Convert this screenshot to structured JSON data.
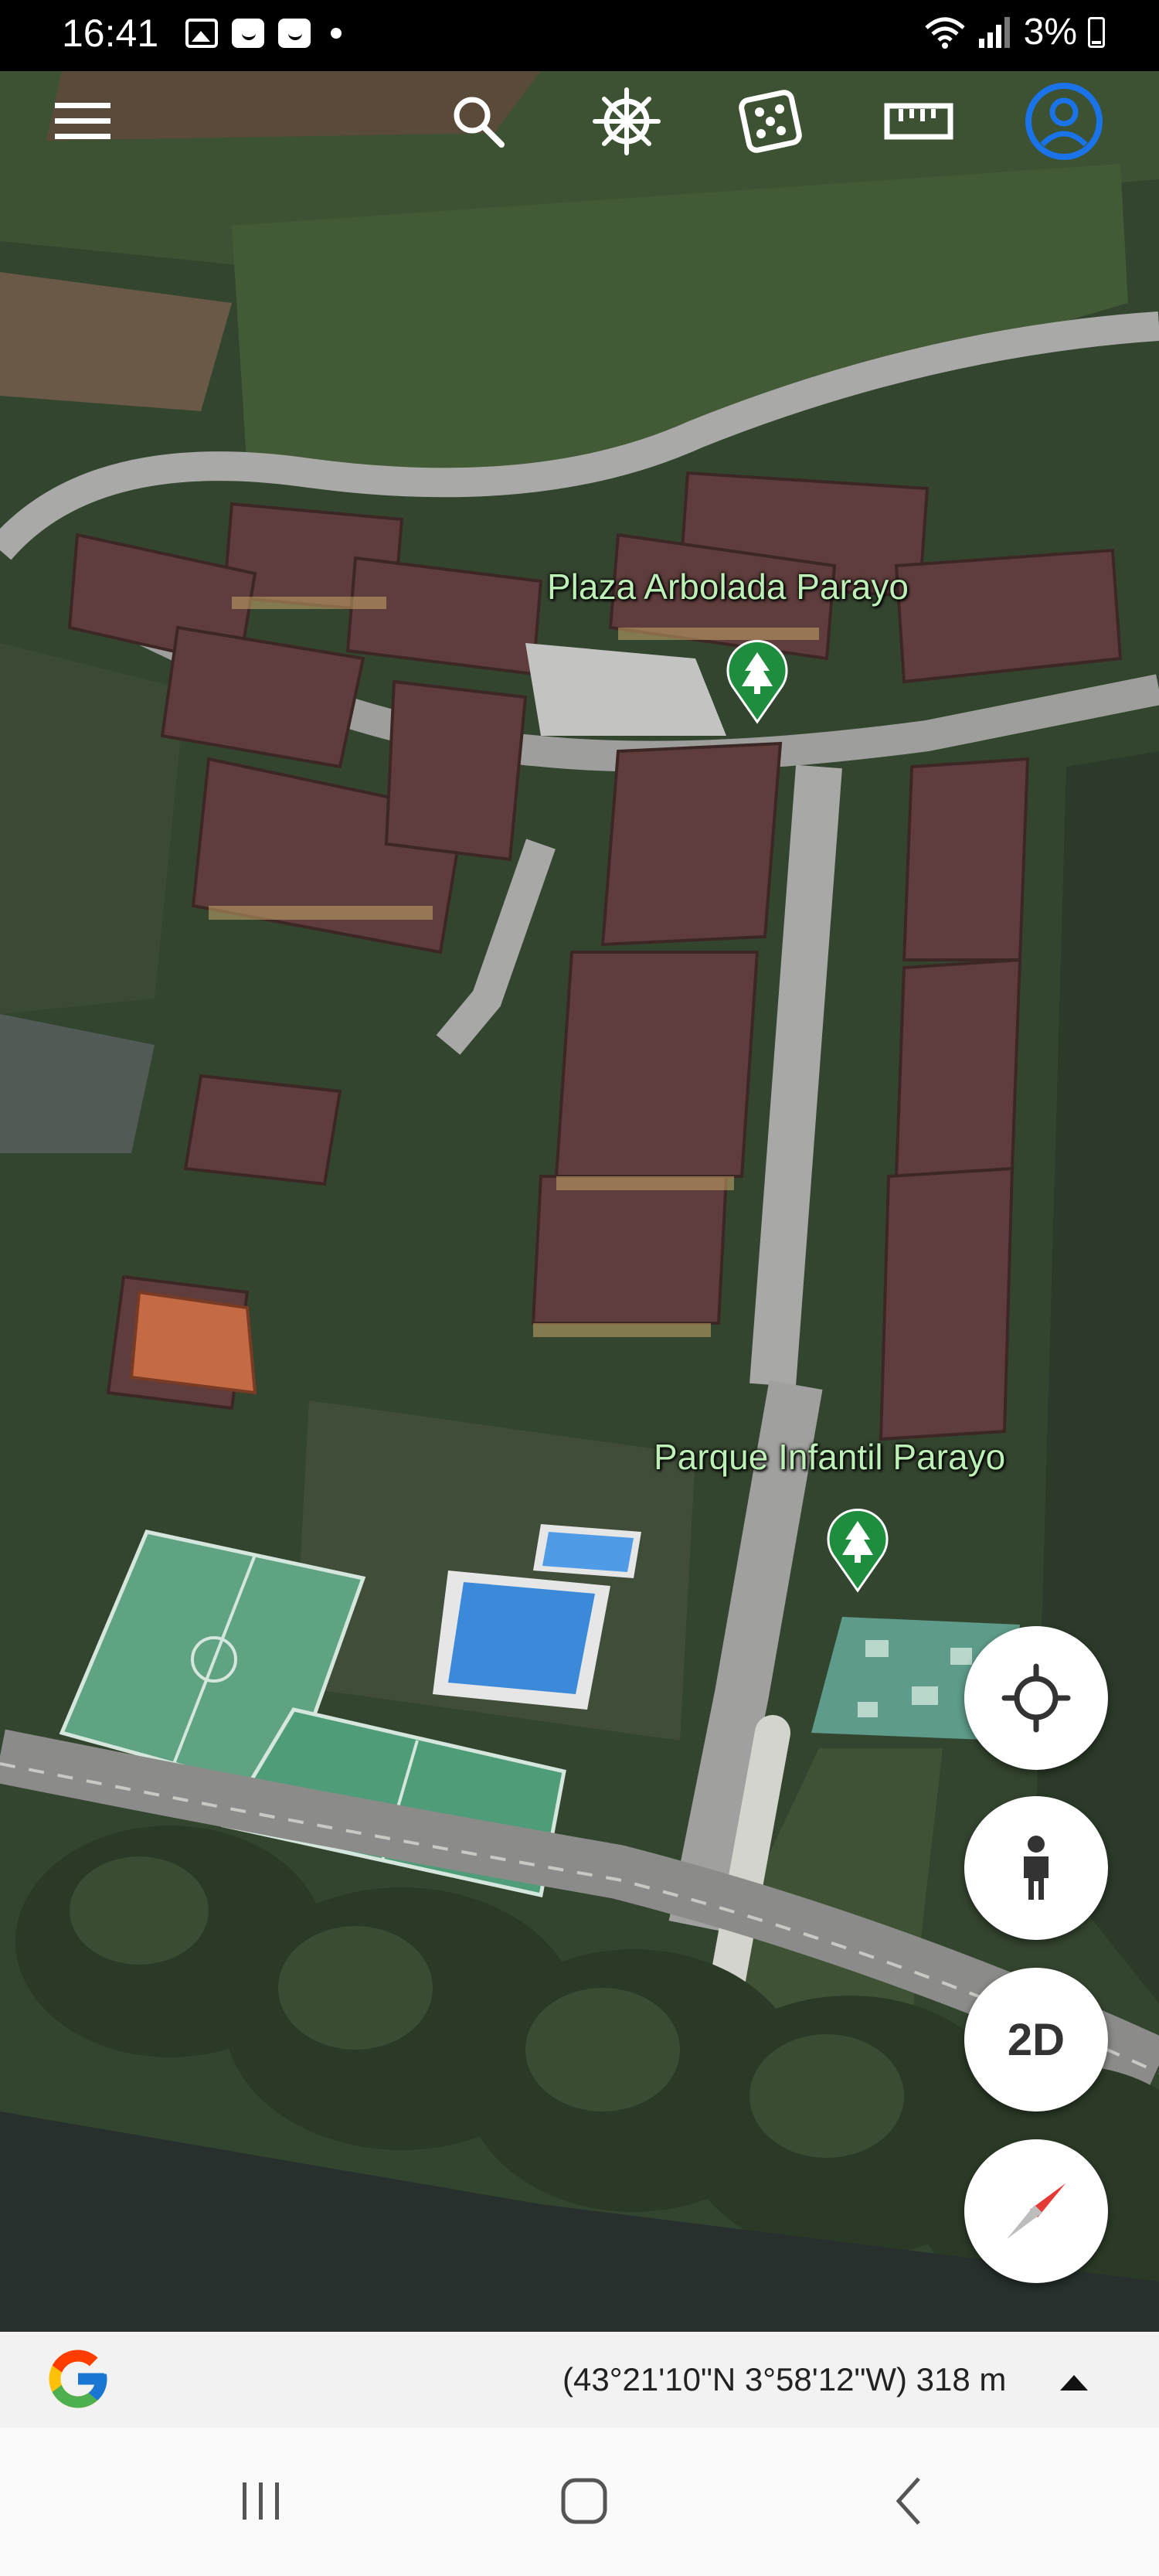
{
  "status_bar": {
    "time": "16:41",
    "notification_icons": [
      "image-icon",
      "smile-icon",
      "smile-icon"
    ],
    "battery": "3%",
    "signal_icons": [
      "wifi-icon",
      "signal-icon"
    ]
  },
  "toolbar": {
    "icons": [
      "menu-icon",
      "search-icon",
      "ship-wheel-icon",
      "dice-icon",
      "ruler-icon",
      "account-icon"
    ],
    "accent_color": "#1a73e8"
  },
  "map": {
    "places": [
      {
        "name": "Plaza Arbolada Parayo",
        "icon": "tree-pin-icon"
      },
      {
        "name": "Parque Infantil Parayo",
        "icon": "tree-pin-icon"
      }
    ],
    "label_color": "#bdf0b6",
    "pin_color": "#1e8e3e"
  },
  "controls": {
    "my_location_icon": "crosshair-icon",
    "street_view_icon": "pegman-icon",
    "view_mode_label": "2D",
    "compass_icon": "compass-icon"
  },
  "info_bar": {
    "logo": "google-g-icon",
    "coordinates": "(43°21'10\"N 3°58'12\"W) 318 m"
  },
  "nav_bar": {
    "icons": [
      "recent-apps-icon",
      "home-icon",
      "back-icon"
    ]
  }
}
